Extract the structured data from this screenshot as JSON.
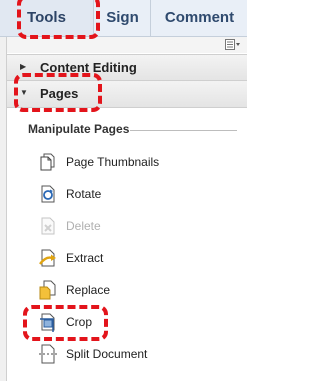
{
  "tabs": [
    {
      "label": "Tools"
    },
    {
      "label": "Sign"
    },
    {
      "label": "Comment"
    }
  ],
  "panel": {
    "options_icon": "list-options-icon",
    "sections": [
      {
        "label": "Content Editing",
        "expanded": false
      },
      {
        "label": "Pages",
        "expanded": true
      }
    ],
    "subsection_title": "Manipulate Pages",
    "items": [
      {
        "label": "Page Thumbnails",
        "icon": "page-thumbnails-icon",
        "enabled": true
      },
      {
        "label": "Rotate",
        "icon": "rotate-icon",
        "enabled": true
      },
      {
        "label": "Delete",
        "icon": "delete-icon",
        "enabled": false
      },
      {
        "label": "Extract",
        "icon": "extract-icon",
        "enabled": true
      },
      {
        "label": "Replace",
        "icon": "replace-icon",
        "enabled": true
      },
      {
        "label": "Crop",
        "icon": "crop-icon",
        "enabled": true
      },
      {
        "label": "Split Document",
        "icon": "split-document-icon",
        "enabled": true
      }
    ]
  },
  "colors": {
    "highlight": "#e3141b",
    "tab_text": "#2f4a6e"
  }
}
